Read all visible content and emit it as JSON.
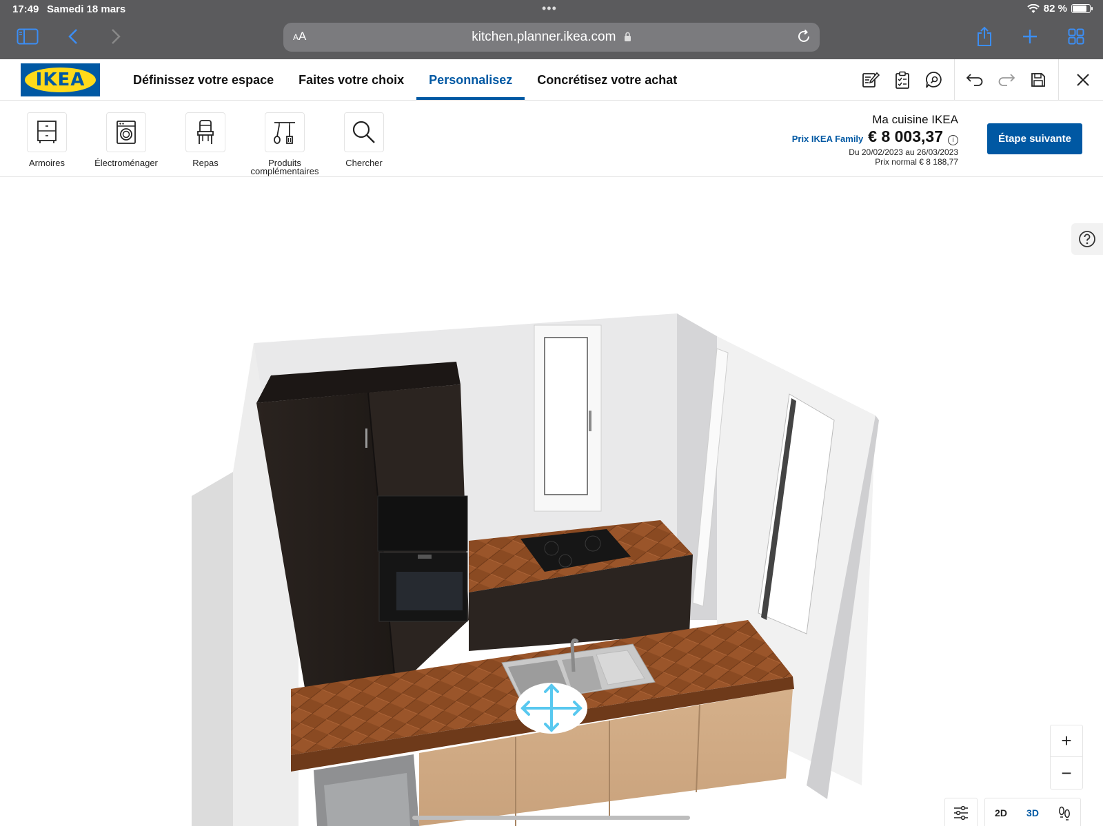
{
  "status": {
    "time": "17:49",
    "date": "Samedi 18 mars",
    "battery": "82 %"
  },
  "browser": {
    "aa": "AA",
    "url": "kitchen.planner.ikea.com"
  },
  "brand": {
    "logo": "IKEA",
    "blue": "#0058a3",
    "yellow": "#ffda1a"
  },
  "nav": {
    "tabs": [
      {
        "label": "Définissez votre espace"
      },
      {
        "label": "Faites votre choix"
      },
      {
        "label": "Personnalisez",
        "active": true
      },
      {
        "label": "Concrétisez votre achat"
      }
    ]
  },
  "header_icons": [
    "notes-icon",
    "checklist-icon",
    "chat-search-icon",
    "undo-icon",
    "redo-icon",
    "save-icon",
    "close-icon"
  ],
  "toolbar": {
    "items": [
      {
        "label": "Armoires",
        "icon": "cabinet-icon"
      },
      {
        "label": "Électroménager",
        "icon": "washing-machine-icon"
      },
      {
        "label": "Repas",
        "icon": "chair-icon"
      },
      {
        "label": "Produits",
        "label2": "complémentaires",
        "icon": "utensils-icon"
      },
      {
        "label": "Chercher",
        "icon": "search-icon"
      }
    ]
  },
  "price": {
    "title": "Ma cuisine IKEA",
    "family_label": "Prix IKEA Family",
    "amount": "€ 8 003,37",
    "dates": "Du 20/02/2023 au 26/03/2023",
    "normal": "Prix normal  € 8 188,77"
  },
  "next_step": "Étape suivante",
  "view": {
    "zoom_in": "+",
    "zoom_out": "−",
    "mode_2d": "2D",
    "mode_3d": "3D",
    "active_mode": "3D"
  }
}
